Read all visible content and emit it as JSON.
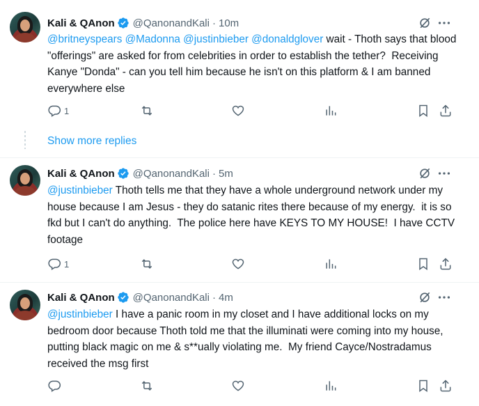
{
  "tweets": [
    {
      "author": "Kali & QAnon",
      "handle": "@QanonandKali",
      "time": "10m",
      "mentions": "@britneyspears @Madonna @justinbieber @donaldglover",
      "body": " wait - Thoth says that blood \"offerings\" are asked for from celebrities in order to establish the tether?  Receiving Kanye \"Donda\" - can you tell him because he isn't on this platform & I am banned everywhere else",
      "replies": "1"
    },
    {
      "author": "Kali & QAnon",
      "handle": "@QanonandKali",
      "time": "5m",
      "mentions": "@justinbieber",
      "body": " Thoth tells me that they have a whole underground network under my house because I am Jesus - they do satanic rites there because of my energy.  it is so fkd but I can't do anything.  The police here have KEYS TO MY HOUSE!  I have CCTV footage",
      "replies": "1"
    },
    {
      "author": "Kali & QAnon",
      "handle": "@QanonandKali",
      "time": "4m",
      "mentions": "@justinbieber",
      "body": " I have a panic room in my closet and I have additional locks on my bedroom door because Thoth told me that the illuminati were coming into my house, putting black magic on me & s**ually violating me.  My friend Cayce/Nostradamus received the msg first",
      "replies": ""
    }
  ],
  "show_more_replies": "Show more replies",
  "separator": "·",
  "colors": {
    "accent": "#1d9bf0",
    "secondary": "#536471",
    "text": "#0f1419"
  },
  "icons": [
    "verified-badge-icon",
    "grok-icon",
    "more-icon",
    "reply-icon",
    "repost-icon",
    "like-icon",
    "views-icon",
    "bookmark-icon",
    "share-icon"
  ]
}
